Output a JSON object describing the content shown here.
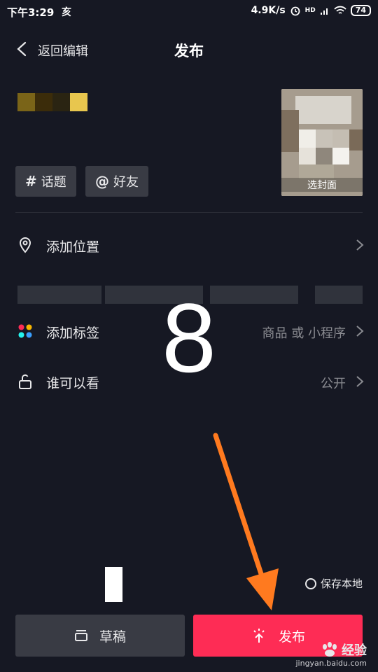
{
  "status_bar": {
    "time": "下午3:29",
    "extra": "亥",
    "network_speed": "4.9K/s",
    "signal": "HD",
    "battery": "74"
  },
  "header": {
    "back_label": "返回编辑",
    "title": "发布"
  },
  "cover": {
    "label": "选封面"
  },
  "chips": {
    "topic_symbol": "#",
    "topic_label": "话题",
    "friend_symbol": "@",
    "friend_label": "好友"
  },
  "rows": {
    "location": {
      "label": "添加位置"
    },
    "tags": {
      "label": "添加标签",
      "value": "商品 或 小程序"
    },
    "visibility": {
      "label": "谁可以看",
      "value": "公开"
    }
  },
  "overlay_step": "8",
  "save_local_label": "保存本地",
  "buttons": {
    "draft_label": "草稿",
    "publish_label": "发布"
  },
  "watermark": {
    "brand": "经验",
    "url": "jingyan.baidu.com"
  },
  "colors": {
    "background": "#161823",
    "publish": "#fe2c55",
    "arrow": "#ff7a1f"
  }
}
